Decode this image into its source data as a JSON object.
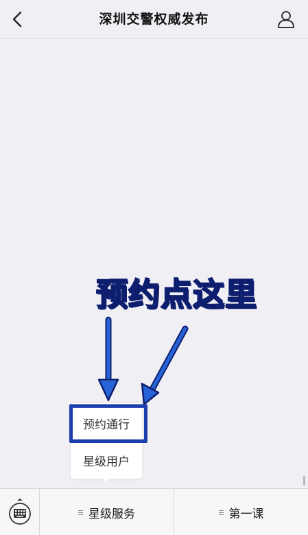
{
  "header": {
    "title": "深圳交警权威发布",
    "back_icon": "chevron-left-icon",
    "profile_icon": "person-icon"
  },
  "annotation": {
    "text": "预约点这里",
    "color": "#2563d6",
    "outline_color": "#0e1e6e"
  },
  "popup_menu": {
    "items": [
      {
        "label": "预约通行"
      },
      {
        "label": "星级用户"
      }
    ],
    "highlight_color": "#1d3fae"
  },
  "bottom_bar": {
    "keyboard_icon": "keyboard-icon",
    "menus": [
      {
        "label": "星级服务"
      },
      {
        "label": "第一课"
      }
    ]
  }
}
